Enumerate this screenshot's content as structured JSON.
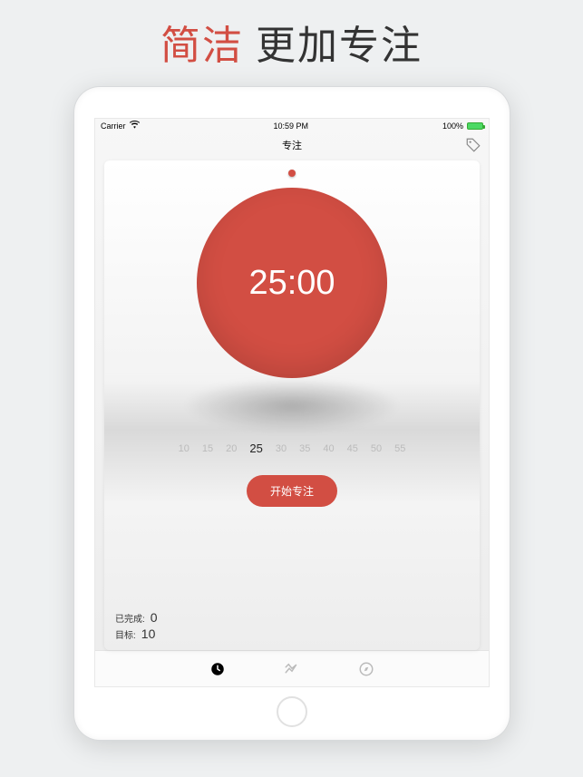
{
  "headline": {
    "part1": "简洁",
    "part2": "更加专注"
  },
  "statusbar": {
    "carrier": "Carrier",
    "time": "10:59 PM",
    "battery_pct": "100%"
  },
  "navbar": {
    "title": "专注"
  },
  "timer": {
    "display": "25:00"
  },
  "ruler": {
    "ticks": [
      "10",
      "15",
      "20",
      "25",
      "30",
      "35",
      "40",
      "45",
      "50",
      "55"
    ],
    "selected": "25"
  },
  "start_button": {
    "label": "开始专注"
  },
  "stats": {
    "completed_label": "已完成:",
    "completed_value": "0",
    "goal_label": "目标:",
    "goal_value": "10"
  },
  "colors": {
    "accent": "#d24e43"
  }
}
